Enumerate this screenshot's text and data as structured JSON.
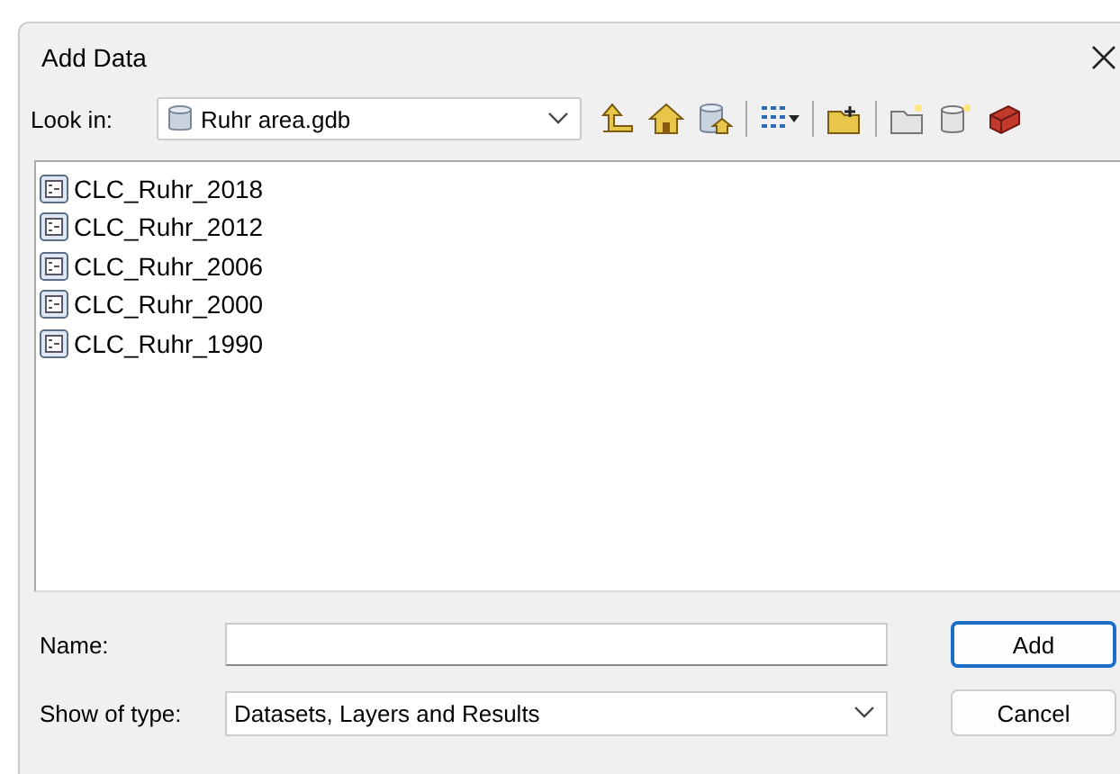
{
  "window": {
    "title": "Add Data"
  },
  "look_in": {
    "label": "Look in:",
    "value": "Ruhr area.gdb"
  },
  "items": [
    {
      "name": "CLC_Ruhr_2018"
    },
    {
      "name": "CLC_Ruhr_2012"
    },
    {
      "name": "CLC_Ruhr_2006"
    },
    {
      "name": "CLC_Ruhr_2000"
    },
    {
      "name": "CLC_Ruhr_1990"
    }
  ],
  "name_field": {
    "label": "Name:"
  },
  "type_field": {
    "label": "Show of type:",
    "value": "Datasets, Layers and Results"
  },
  "buttons": [
    "Add",
    "Cancel"
  ]
}
